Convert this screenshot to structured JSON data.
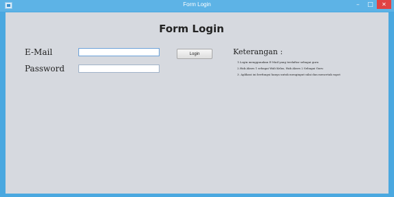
{
  "window": {
    "title": "Form Login",
    "minimize_glyph": "–",
    "maximize_glyph": "□",
    "close_glyph": "✕"
  },
  "form": {
    "heading": "Form Login",
    "email_label": "E-Mail",
    "password_label": "Password",
    "email_value": "",
    "password_value": "",
    "login_button": "Login"
  },
  "keterangan": {
    "title": "Keterangan :",
    "lines": [
      "1.Login menggunakan E-Mail yang terdaftar sebagai guru",
      "2.Hak Akses 1 sebagai Wali Kelas, Hak Akses 2 Sebagai Guru",
      "3. Aplikasi ini berfungsi hanya untuk menginput nilai dan mencetak rapot"
    ]
  },
  "colors": {
    "titlebar": "#5db3e6",
    "client_bg": "#d6d9df",
    "close_button": "#e04343"
  }
}
